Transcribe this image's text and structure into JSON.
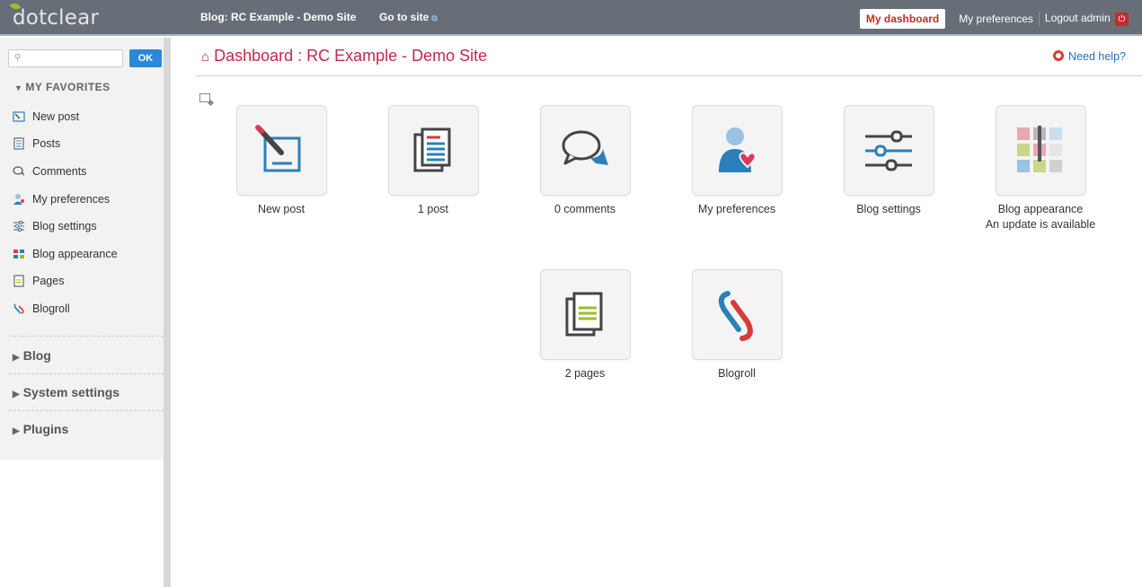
{
  "topbar": {
    "logo": "dotclear",
    "blog_name": "Blog: RC Example - Demo Site",
    "go_to_site": "Go to site",
    "my_dashboard": "My dashboard",
    "my_preferences": "My preferences",
    "logout": "Logout admin",
    "colors": {
      "bar": "#676e78",
      "dashboard_text": "#c02c2c"
    }
  },
  "sidebar": {
    "search": {
      "placeholder": "",
      "button": "OK"
    },
    "favorites_heading": "My favorites",
    "favorites": [
      {
        "label": "New post",
        "icon": "new-post-icon"
      },
      {
        "label": "Posts",
        "icon": "posts-icon"
      },
      {
        "label": "Comments",
        "icon": "comments-icon"
      },
      {
        "label": "My preferences",
        "icon": "user-icon"
      },
      {
        "label": "Blog settings",
        "icon": "settings-icon"
      },
      {
        "label": "Blog appearance",
        "icon": "appearance-icon"
      },
      {
        "label": "Pages",
        "icon": "pages-icon"
      },
      {
        "label": "Blogroll",
        "icon": "blogroll-icon"
      }
    ],
    "groups": [
      {
        "label": "Blog"
      },
      {
        "label": "System settings"
      },
      {
        "label": "Plugins"
      }
    ]
  },
  "main": {
    "title": "Dashboard : RC Example - Demo Site",
    "need_help": "Need help?",
    "tiles": [
      {
        "label": "New post",
        "icon": "new-post-icon"
      },
      {
        "label": "1 post",
        "icon": "posts-icon"
      },
      {
        "label": "0 comments",
        "icon": "comments-icon"
      },
      {
        "label": "My preferences",
        "icon": "user-icon"
      },
      {
        "label": "Blog settings",
        "icon": "settings-icon"
      },
      {
        "label": "Blog appearance",
        "sub": "An update is available",
        "icon": "appearance-icon"
      },
      {
        "label": "2 pages",
        "icon": "pages-icon"
      },
      {
        "label": "Blogroll",
        "icon": "blogroll-icon"
      }
    ]
  }
}
